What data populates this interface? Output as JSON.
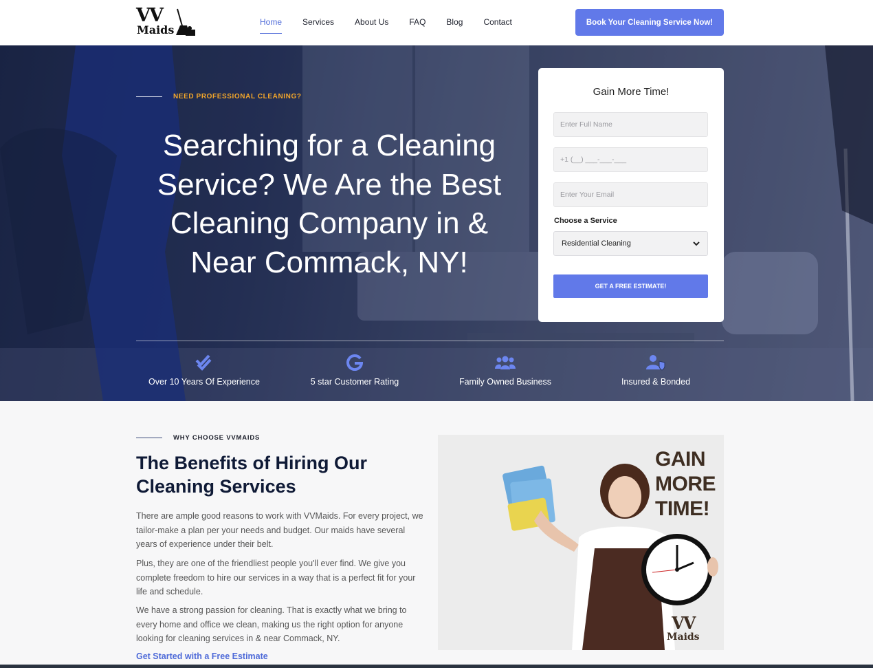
{
  "brand": {
    "logo_line1": "VV",
    "logo_line2": "Maids"
  },
  "nav": [
    {
      "label": "Home",
      "active": true
    },
    {
      "label": "Services"
    },
    {
      "label": "About Us"
    },
    {
      "label": "FAQ"
    },
    {
      "label": "Blog"
    },
    {
      "label": "Contact"
    }
  ],
  "header_cta": "Book Your Cleaning Service Now!",
  "hero": {
    "eyebrow": "NEED PROFESSIONAL CLEANING?",
    "title": "Searching for a Cleaning Service? We Are the Best Cleaning Company in & Near Commack, NY!"
  },
  "form": {
    "title": "Gain More Time!",
    "name_placeholder": "Enter Full Name",
    "phone_placeholder": "+1 (__) ___-___-___",
    "email_placeholder": "Enter Your Email",
    "service_label": "Choose a Service",
    "service_value": "Residential Cleaning",
    "submit": "GET A FREE ESTIMATE!"
  },
  "features": [
    {
      "icon": "double-check-icon",
      "label": "Over 10 Years Of Experience"
    },
    {
      "icon": "google-icon",
      "label": "5 star Customer Rating"
    },
    {
      "icon": "family-icon",
      "label": "Family Owned Business"
    },
    {
      "icon": "user-shield-icon",
      "label": "Insured & Bonded"
    }
  ],
  "benefits": {
    "eyebrow": "WHY CHOOSE VVMAIDS",
    "title": "The Benefits of Hiring Our Cleaning Services",
    "paragraphs": [
      "There are ample good reasons to work with VVMaids. For every project, we tailor-make a plan per your needs and budget. Our maids have several years of experience under their belt.",
      "Plus, they are one of the friendliest people you'll ever find. We give you complete freedom to hire our services in a way that is a perfect fit for your life and schedule.",
      "We have a strong passion for cleaning. That is exactly what we bring to every home and office we clean, making us the right option for anyone looking for cleaning services in & near Commack, NY."
    ],
    "link": "Get Started with a Free Estimate"
  },
  "promo": {
    "line1": "GAIN",
    "line2": "MORE",
    "line3": "TIME!",
    "logo_line1": "VV",
    "logo_line2": "Maids"
  },
  "colors": {
    "accent": "#6179e9",
    "eyebrow": "#f4a72a",
    "heading": "#0f1a36"
  }
}
